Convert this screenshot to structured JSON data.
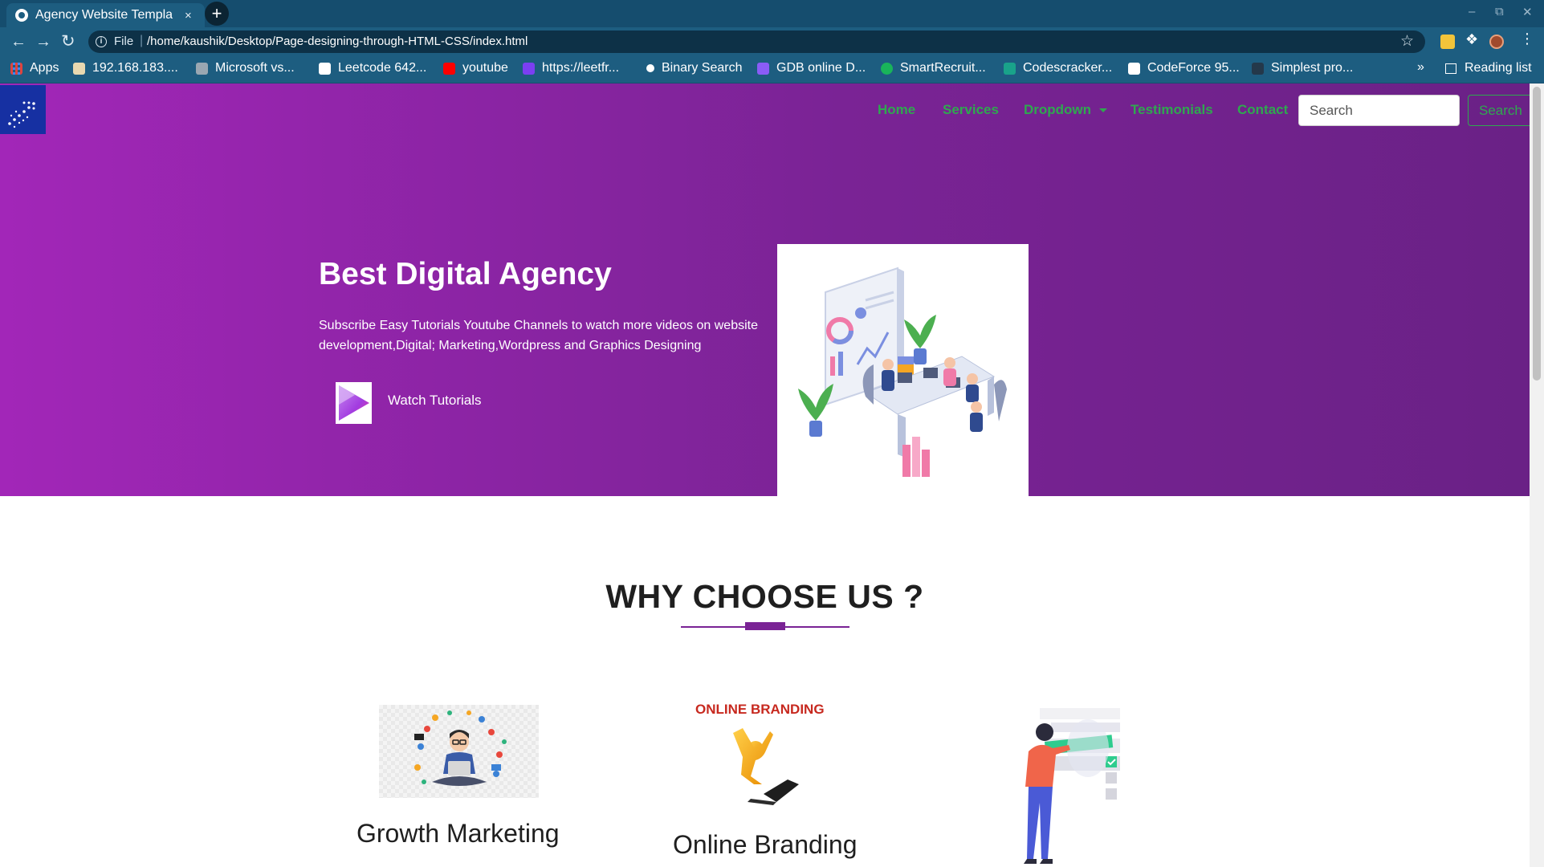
{
  "browser": {
    "tab_title": "Agency Website Templa",
    "tab_close": "×",
    "new_tab": "+",
    "file_label": "File",
    "url": "/home/kaushik/Desktop/Page-designing-through-HTML-CSS/index.html",
    "bookmarks": [
      {
        "label": "Apps",
        "color": "#e0443e"
      },
      {
        "label": "192.168.183....",
        "color": "#e8d8b0"
      },
      {
        "label": "Microsoft vs...",
        "color": "#9aa7b2"
      },
      {
        "label": "Leetcode 642...",
        "color": "#ffffff"
      },
      {
        "label": "youtube",
        "color": "#ff0000"
      },
      {
        "label": "https://leetfr...",
        "color": "#7b3ff2"
      },
      {
        "label": "Binary Search",
        "color": "#ffffff"
      },
      {
        "label": "GDB online D...",
        "color": "#8a5cf6"
      },
      {
        "label": "SmartRecruit...",
        "color": "#19b45a"
      },
      {
        "label": "Codescracker...",
        "color": "#19a38a"
      },
      {
        "label": "CodeForce 95...",
        "color": "#ffffff"
      },
      {
        "label": "Simplest pro...",
        "color": "#24384a"
      }
    ],
    "bookmarks_more": "»",
    "reading_list": "Reading list"
  },
  "nav": {
    "links": [
      "Home",
      "Services",
      "Dropdown",
      "Testimonials",
      "Contact"
    ],
    "search_placeholder": "Search",
    "search_button": "Search",
    "link_color": "#2fa84f"
  },
  "hero": {
    "title": "Best Digital Agency",
    "description": "Subscribe Easy Tutorials Youtube Channels to watch more videos on website development,Digital; Marketing,Wordpress and Graphics Designing",
    "cta_label": "Watch Tutorials",
    "gradient_start": "#a226b8",
    "gradient_end": "#6a2186"
  },
  "why": {
    "title": "WHY CHOOSE US ?",
    "features": [
      {
        "title": "Growth Marketing",
        "icon": "growth-marketing-illustration"
      },
      {
        "title": "Online Branding",
        "caption": "ONLINE BRANDING",
        "icon": "online-branding-illustration"
      },
      {
        "title": "",
        "icon": "person-checklist-illustration"
      }
    ]
  }
}
